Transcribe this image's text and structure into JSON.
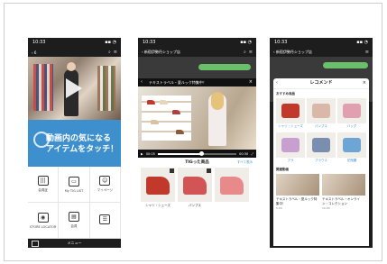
{
  "colors": {
    "accent": "#3d8fce",
    "chat_bubble": "#6ac06a",
    "phone_bg": "#1d1d1d"
  },
  "phone1": {
    "status_time": "10:33",
    "status_icons": "▪▪ ◔",
    "header_back": "‹ 6",
    "banner_line1": "動画内の気になる",
    "banner_line2": "アイテムをタッチ！",
    "grid": [
      {
        "icon": "barcode-icon",
        "glyph": "|||",
        "label": "会員証"
      },
      {
        "icon": "tv-icon",
        "glyph": "▭",
        "label": "My TIG LIST"
      },
      {
        "icon": "profile-icon",
        "glyph": "☺",
        "label": "マイページ"
      },
      {
        "icon": "location-icon",
        "glyph": "◉",
        "label": "STORE LOCATOR"
      },
      {
        "icon": "document-icon",
        "glyph": "▤",
        "label": "会員"
      },
      {
        "icon": "note-icon",
        "glyph": "☰",
        "label": ""
      }
    ],
    "menu_label": "メニュー"
  },
  "phone2": {
    "chat_title": "‹ 新宿伊勢丹ショップ店",
    "video_title": "テキストラベル・夏ルック特集中！",
    "time_current": "00:05",
    "time_total": "00:30",
    "progress": 0.55,
    "products_heading": "TIGった商品",
    "products_more": "すべて表示",
    "products": [
      {
        "name": "シャツ・シューズ",
        "color": "#c0392b"
      },
      {
        "name": "パンプス",
        "color": "#d35454"
      },
      {
        "name": "",
        "color": "#e98a8a"
      }
    ]
  },
  "phone3": {
    "header_title": "レコメンド",
    "section1": "おすすめ商品",
    "items": [
      {
        "name": "シャツ・シューズ",
        "color": "#c0392b"
      },
      {
        "name": "パンプス",
        "color": "#d9b8a8"
      },
      {
        "name": "バッグ",
        "color": "#e0a0b0"
      },
      {
        "name": "ブラ",
        "color": "#c8a0d0"
      },
      {
        "name": "ブラウス",
        "color": "#7a8fb0"
      },
      {
        "name": "花瓶類",
        "color": "#6da6d4"
      }
    ],
    "section2": "関連動画",
    "videos": [
      {
        "caption": "テキストラベル・夏ルック特集中！",
        "sub": "5:00"
      },
      {
        "caption": "テキストラベル・オンライン・コレクション",
        "sub": "10:00"
      }
    ]
  }
}
